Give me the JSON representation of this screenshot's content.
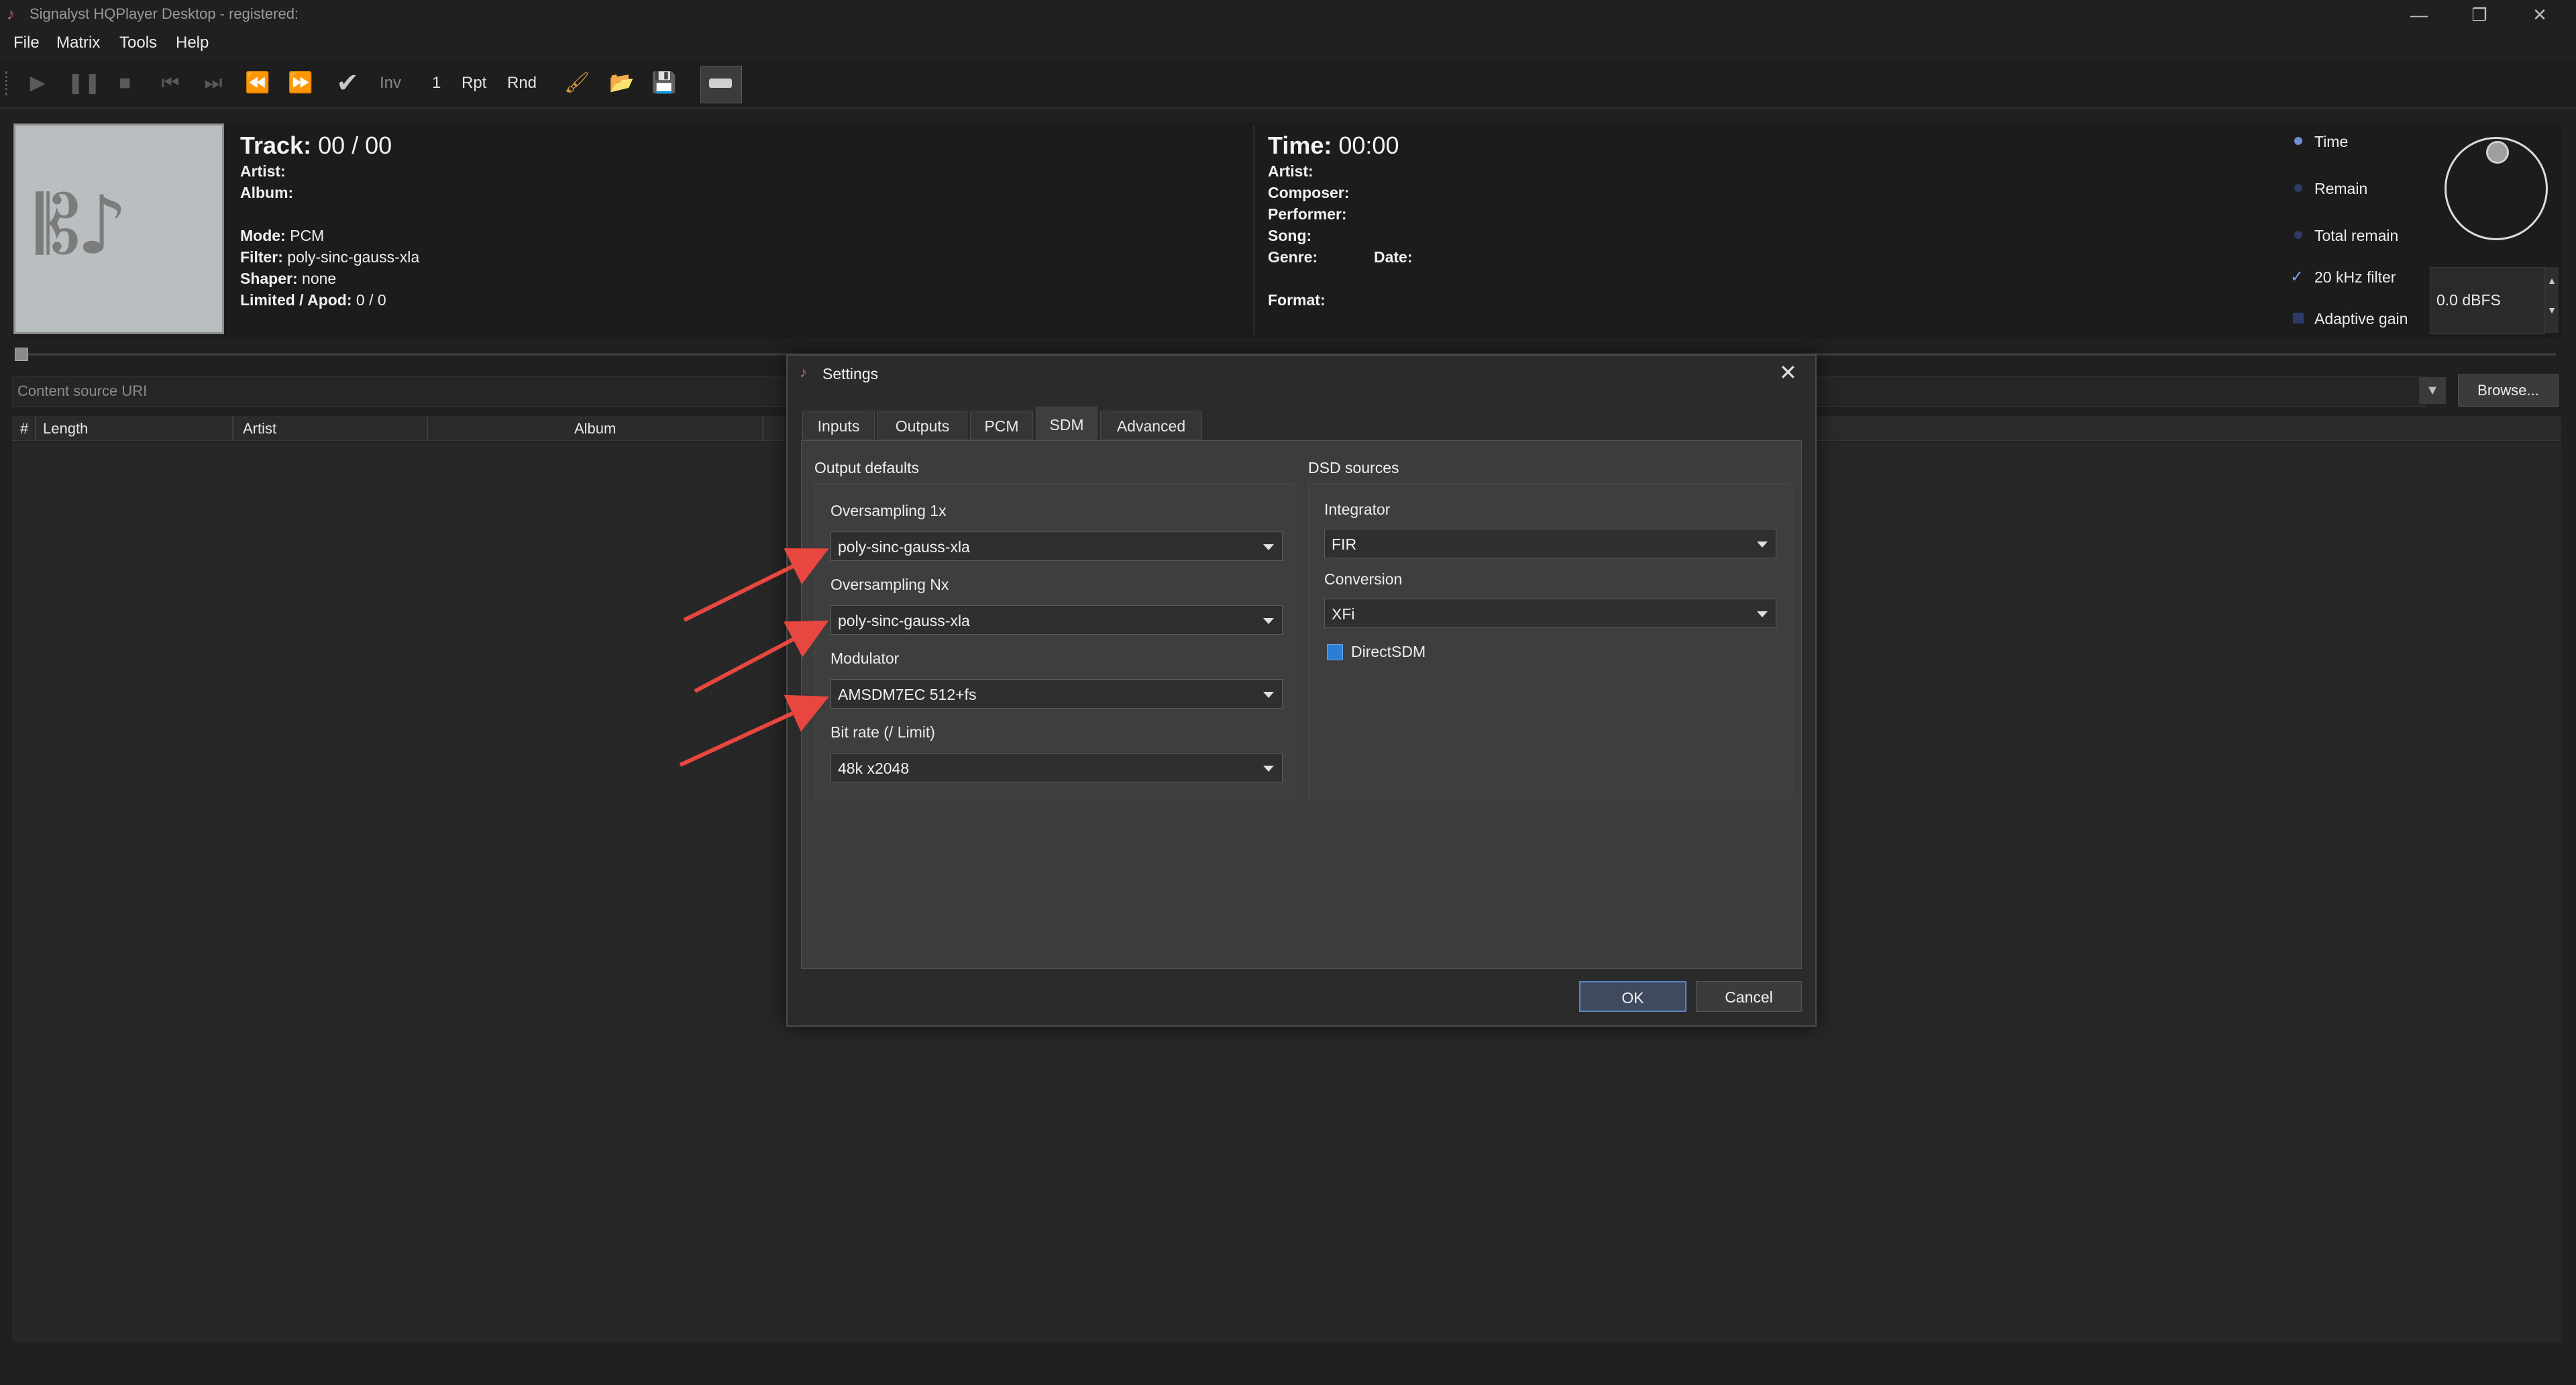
{
  "app": {
    "title": "Signalyst HQPlayer Desktop - registered:",
    "logo_icon": "hqplayer-logo-icon"
  },
  "window_controls": {
    "minimize": "—",
    "restore": "❐",
    "close": "✕"
  },
  "menu": {
    "file": "File",
    "matrix": "Matrix",
    "tools": "Tools",
    "help": "Help"
  },
  "toolbar": {
    "inv": "Inv",
    "one": "1",
    "rpt": "Rpt",
    "rnd": "Rnd"
  },
  "track_info": {
    "track_label": "Track:",
    "track_value": "00 / 00",
    "artist_label": "Artist:",
    "album_label": "Album:",
    "mode_label": "Mode:",
    "mode_value": "PCM",
    "filter_label": "Filter:",
    "filter_value": "poly-sinc-gauss-xla",
    "shaper_label": "Shaper:",
    "shaper_value": "none",
    "limited_label": "Limited / Apod:",
    "limited_value": "0 / 0"
  },
  "time_info": {
    "time_label": "Time:",
    "time_value": "00:00",
    "artist_label": "Artist:",
    "composer_label": "Composer:",
    "performer_label": "Performer:",
    "song_label": "Song:",
    "genre_label": "Genre:",
    "date_label": "Date:",
    "format_label": "Format:"
  },
  "side_panel": {
    "time": "Time",
    "remain": "Remain",
    "total_remain": "Total remain",
    "filter_20k": "20 kHz filter",
    "adaptive_gain": "Adaptive gain",
    "gain_value": "0.0 dBFS"
  },
  "uri": {
    "placeholder": "Content source URI",
    "browse": "Browse..."
  },
  "playlist": {
    "columns": [
      "#",
      "Length",
      "Artist",
      "Album"
    ]
  },
  "dialog": {
    "title": "Settings",
    "tabs": [
      "Inputs",
      "Outputs",
      "PCM",
      "SDM",
      "Advanced"
    ],
    "active_tab": "SDM",
    "output_defaults": {
      "title": "Output defaults",
      "oversampling_1x_label": "Oversampling 1x",
      "oversampling_1x_value": "poly-sinc-gauss-xla",
      "oversampling_nx_label": "Oversampling Nx",
      "oversampling_nx_value": "poly-sinc-gauss-xla",
      "modulator_label": "Modulator",
      "modulator_value": "AMSDM7EC 512+fs",
      "bitrate_label": "Bit rate (/ Limit)",
      "bitrate_value": "48k x2048"
    },
    "dsd_sources": {
      "title": "DSD sources",
      "integrator_label": "Integrator",
      "integrator_value": "FIR",
      "conversion_label": "Conversion",
      "conversion_value": "XFi",
      "directsdm_label": "DirectSDM",
      "directsdm_checked": true
    },
    "ok": "OK",
    "cancel": "Cancel"
  },
  "colors": {
    "background": "#202020",
    "dialog_bg": "#2b2b2b",
    "pane_bg": "#3c3c3c",
    "annotation_arrow": "#e8473f",
    "checkbox_accent": "#2a7fd4"
  }
}
